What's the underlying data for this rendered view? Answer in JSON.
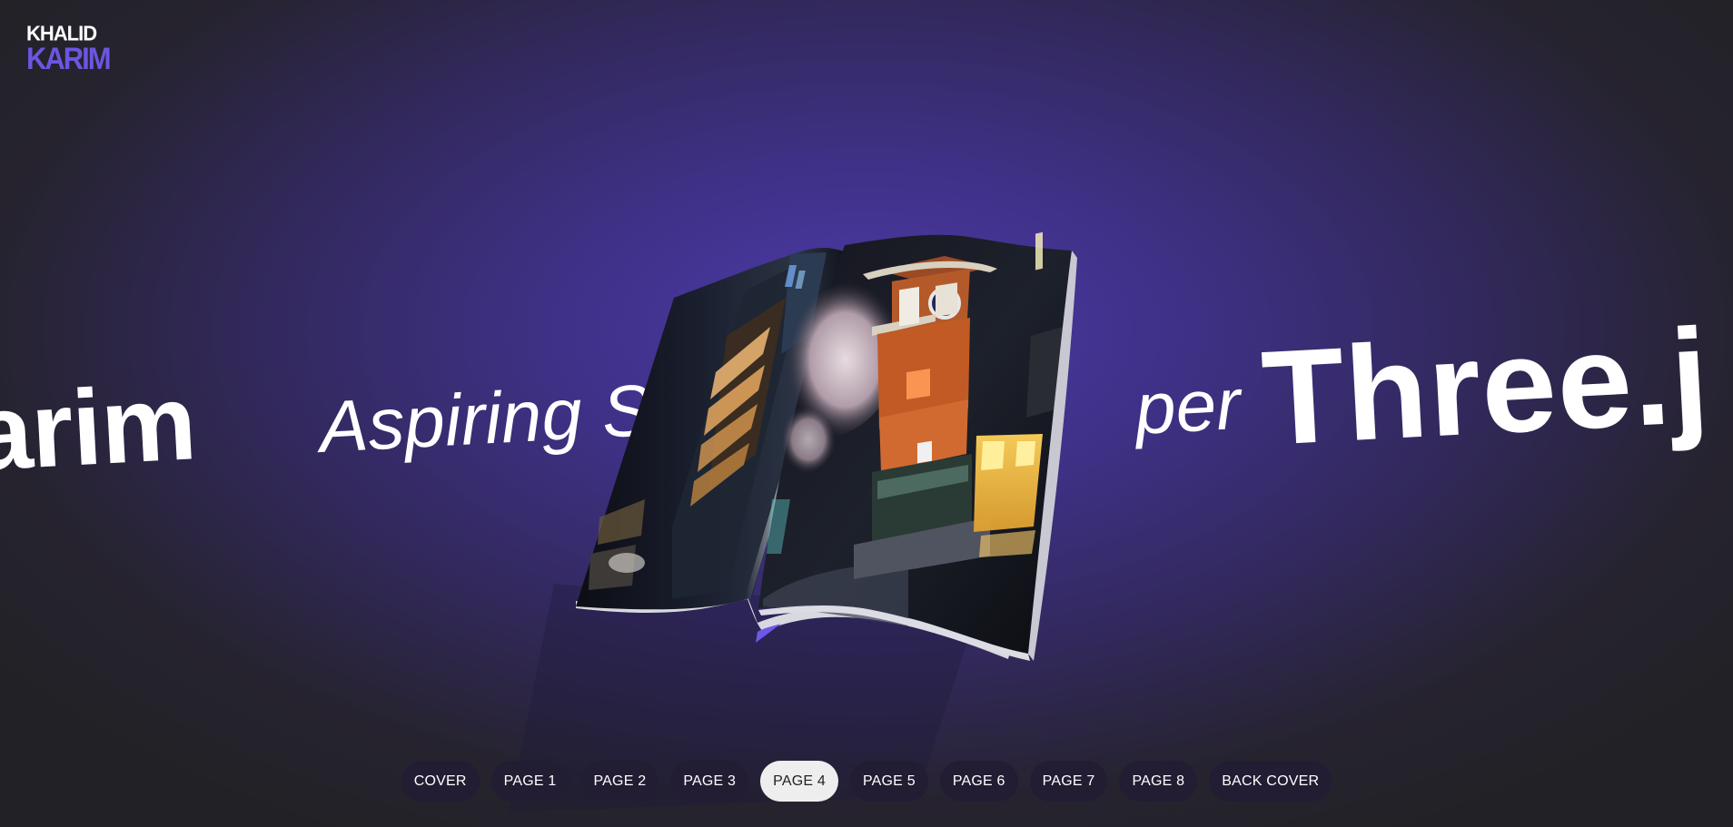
{
  "logo": {
    "line1": "KHALID",
    "line2": "KARIM"
  },
  "marquee": {
    "name": "arim",
    "aspiring": "Aspiring So",
    "per": "per",
    "three": "Three.j"
  },
  "pages": [
    {
      "label": "COVER",
      "active": false
    },
    {
      "label": "PAGE 1",
      "active": false
    },
    {
      "label": "PAGE 2",
      "active": false
    },
    {
      "label": "PAGE 3",
      "active": false
    },
    {
      "label": "PAGE 4",
      "active": true
    },
    {
      "label": "PAGE 5",
      "active": false
    },
    {
      "label": "PAGE 6",
      "active": false
    },
    {
      "label": "PAGE 7",
      "active": false
    },
    {
      "label": "PAGE 8",
      "active": false
    },
    {
      "label": "BACK COVER",
      "active": false
    }
  ],
  "colors": {
    "accent": "#6c55e0",
    "active_button": "#eeeeee",
    "button": "#221d33"
  }
}
